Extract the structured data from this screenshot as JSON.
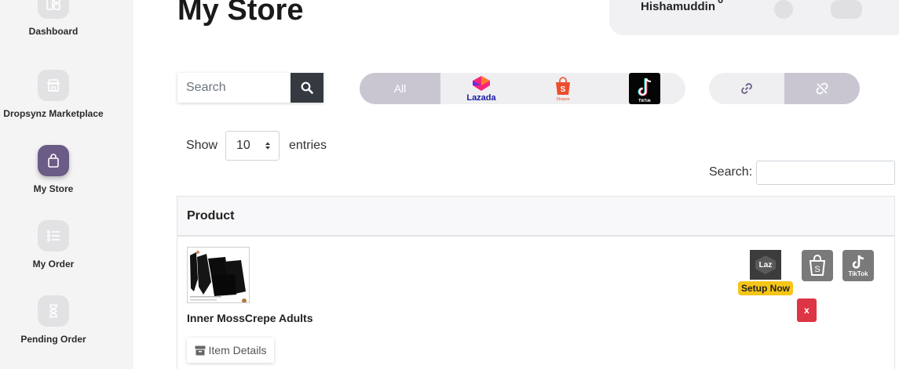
{
  "sidebar": {
    "items": [
      {
        "label": "Dashboard",
        "icon": "dashboard-icon",
        "active": false
      },
      {
        "label": "Dropsynz Marketplace",
        "icon": "store-icon",
        "active": false
      },
      {
        "label": "My Store",
        "icon": "bag-icon",
        "active": true
      },
      {
        "label": "My Order",
        "icon": "list-icon",
        "active": false
      },
      {
        "label": "Pending Order",
        "icon": "hourglass-icon",
        "active": false
      }
    ]
  },
  "header": {
    "title": "My Store",
    "user_name": "Hishamuddin",
    "user_badge": "0"
  },
  "search": {
    "placeholder": "Search"
  },
  "platform_filter": {
    "all_label": "All",
    "lazada_label": "Lazada",
    "shopee_label": "Shopee",
    "tiktok_label": "TikTok"
  },
  "entries": {
    "show_label": "Show",
    "value": "10",
    "entries_label": "entries",
    "search_label": "Search:"
  },
  "table": {
    "columns": [
      "Product"
    ],
    "rows": [
      {
        "product_name": "Inner MossCrepe Adults",
        "item_details_label": "Item Details",
        "lazada_short": "Laz",
        "setup_label": "Setup Now",
        "tiktok_label": "TikTok",
        "remove_label": "x"
      }
    ]
  },
  "colors": {
    "accent": "#6b5b87",
    "filter_active": "#c9c6d2",
    "search_button": "#343a40",
    "setup_badge": "#f5c518",
    "remove": "#dc3545"
  }
}
